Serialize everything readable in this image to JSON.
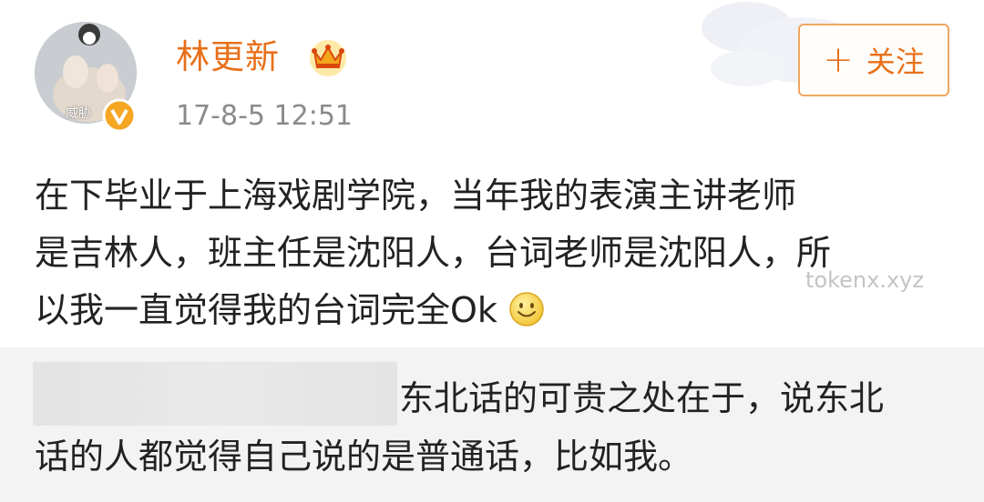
{
  "post": {
    "author": {
      "name": "林更新",
      "avatar_label": "威胁",
      "badges": [
        "crown-icon",
        "verified-icon"
      ]
    },
    "timestamp": "17-8-5 12:51",
    "follow_button": {
      "label": "关注",
      "icon": "plus-icon"
    },
    "body_lines": [
      "在下毕业于上海戏剧学院，当年我的表演主讲老师",
      "是吉林人，班主任是沈阳人，台词老师是沈阳人，所",
      "以我一直觉得我的台词完全Ok"
    ],
    "emoji": "smile-icon",
    "watermark": "tokenx.xyz"
  },
  "reply": {
    "lines": [
      "东北话的可贵之处在于，说东北",
      "话的人都觉得自己说的是普通话，比如我。"
    ]
  },
  "colors": {
    "accent": "#e8701a",
    "button_border": "#f0a760",
    "timestamp": "#8a8a8a",
    "text": "#222222",
    "reply_bg": "#f3f3f3"
  }
}
